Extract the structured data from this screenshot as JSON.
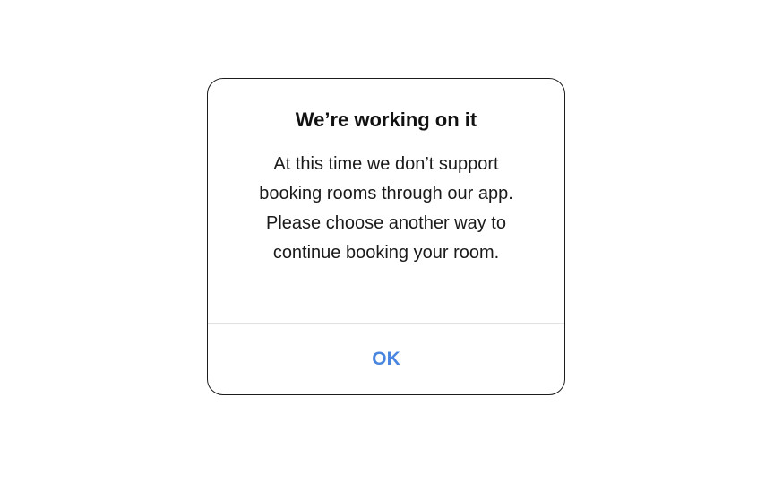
{
  "dialog": {
    "title": "We’re working on it",
    "message_lines": [
      "At this time we don’t support",
      "booking rooms through our app.",
      "Please choose another way to",
      "continue booking your room."
    ],
    "ok_label": "OK"
  },
  "colors": {
    "accent": "#4a86e0",
    "border": "#1c1c1c",
    "divider": "#e2e2e2",
    "background": "#ffffff"
  }
}
